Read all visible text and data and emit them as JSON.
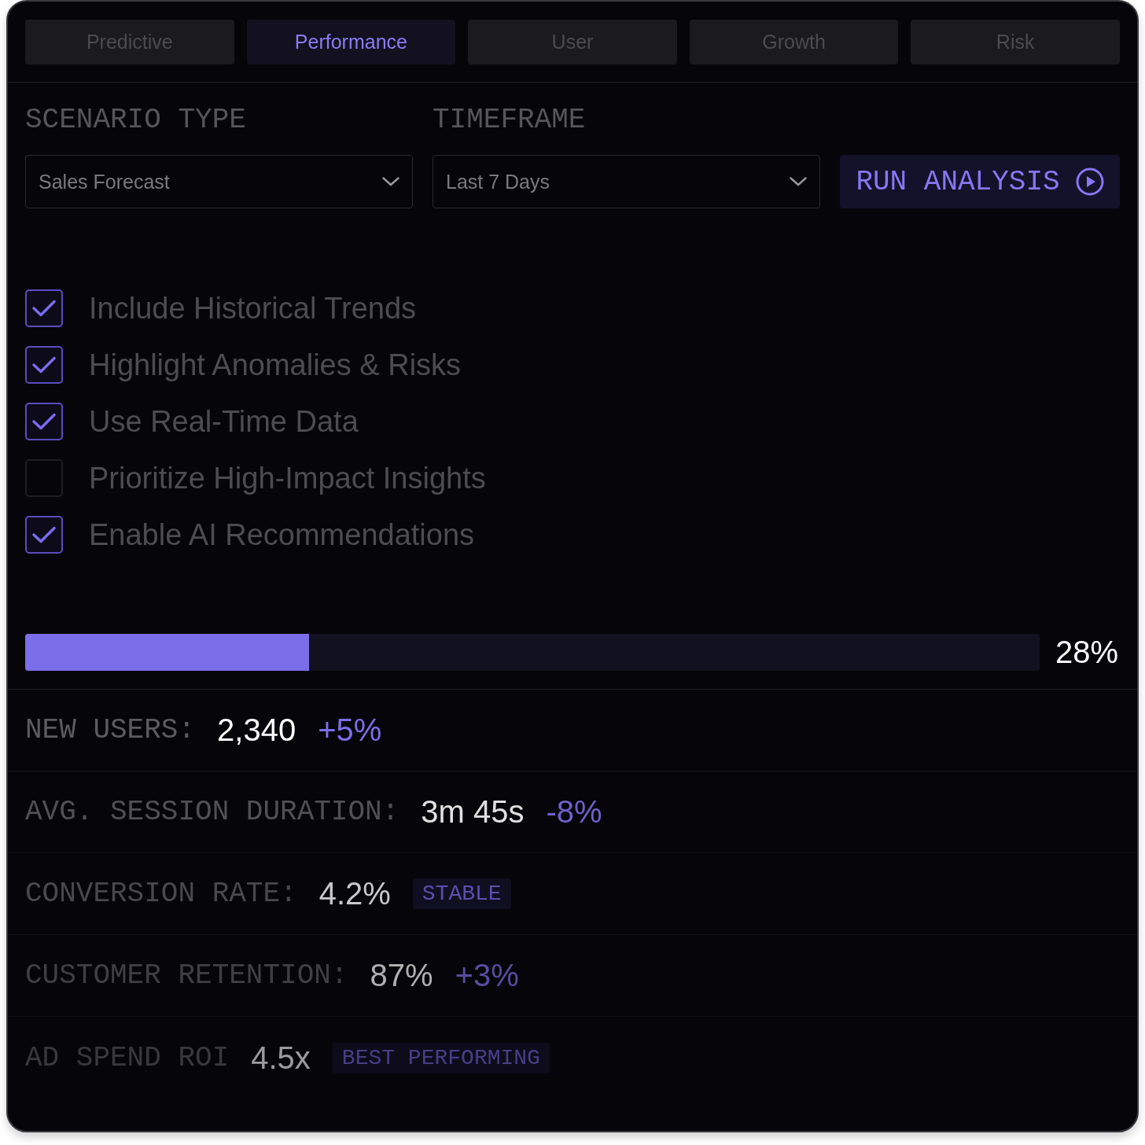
{
  "tabs": [
    {
      "label": "Predictive",
      "selected": false
    },
    {
      "label": "Performance",
      "selected": true
    },
    {
      "label": "User",
      "selected": false
    },
    {
      "label": "Growth",
      "selected": false
    },
    {
      "label": "Risk",
      "selected": false
    }
  ],
  "fields": [
    {
      "label": "SCENARIO TYPE",
      "value": "Sales Forecast"
    },
    {
      "label": "TIMEFRAME",
      "value": "Last 7 Days"
    }
  ],
  "run_button": {
    "label": "RUN ANALYSIS"
  },
  "options": [
    {
      "label": "Include Historical Trends",
      "checked": true
    },
    {
      "label": "Highlight Anomalies & Risks",
      "checked": true
    },
    {
      "label": "Use Real-Time Data",
      "checked": true
    },
    {
      "label": "Prioritize High-Impact Insights",
      "checked": false
    },
    {
      "label": "Enable AI Recommendations",
      "checked": true
    }
  ],
  "progress": {
    "level": 0.28,
    "reading": "28%"
  },
  "metrics": [
    {
      "kind": "change",
      "label": "NEW USERS:",
      "value": "2,340",
      "tag": "+5%"
    },
    {
      "kind": "change",
      "label": "AVG. SESSION DURATION:",
      "value": "3m 45s",
      "tag": "-8%"
    },
    {
      "kind": "badge",
      "label": "CONVERSION RATE:",
      "value": "4.2%",
      "tag": "STABLE"
    },
    {
      "kind": "change",
      "label": "CUSTOMER RETENTION:",
      "value": "87%",
      "tag": "+3%"
    },
    {
      "kind": "badge",
      "label": "AD SPEND ROI",
      "value": "4.5x",
      "tag": "BEST PERFORMING"
    }
  ]
}
